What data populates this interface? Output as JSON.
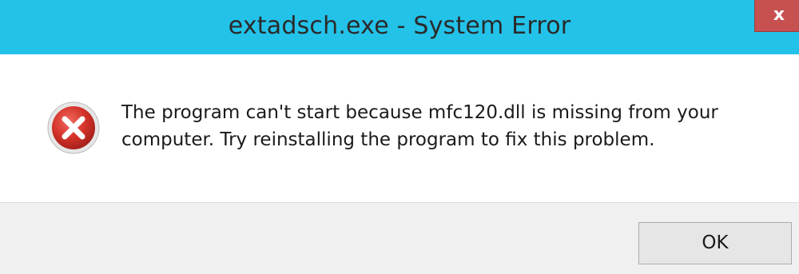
{
  "window": {
    "title": "extadsch.exe - System Error",
    "close_label": "x",
    "accent_color": "#23c2e9",
    "close_color": "#c75050"
  },
  "message": {
    "line1": "The program can't start because mfc120.dll is missing from your",
    "line2": "computer. Try reinstalling the program to fix this problem.",
    "icon": "error-icon"
  },
  "buttons": {
    "ok_label": "OK"
  }
}
